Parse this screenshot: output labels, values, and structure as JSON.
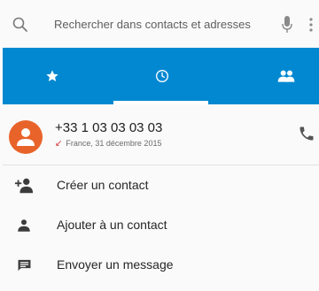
{
  "search": {
    "placeholder": "Rechercher dans contacts et adresses",
    "icon": "search-icon",
    "voice_icon": "mic-icon",
    "overflow_icon": "more-vert-icon"
  },
  "tabs": [
    {
      "icon": "star-icon",
      "active": false
    },
    {
      "icon": "clock-icon",
      "active": true
    },
    {
      "icon": "people-icon",
      "active": false
    }
  ],
  "call_entry": {
    "number": "+33 1 03 03 03 03",
    "missed_indicator": "↙",
    "details": "France, 31 décembre 2015",
    "avatar_color": "#e8632a",
    "call_icon": "phone-icon"
  },
  "actions": [
    {
      "label": "Créer un contact",
      "icon": "person-add-icon"
    },
    {
      "label": "Ajouter à un contact",
      "icon": "person-icon"
    },
    {
      "label": "Envoyer un message",
      "icon": "message-icon"
    }
  ],
  "colors": {
    "accent": "#0288d1",
    "missed": "#d32f2f"
  }
}
